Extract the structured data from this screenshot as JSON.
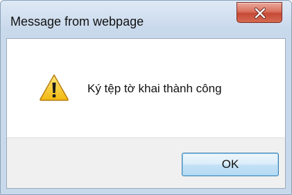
{
  "window": {
    "title": "Message from webpage"
  },
  "dialog": {
    "icon": "warning-icon",
    "message": "Ký tệp tờ khai thành công",
    "ok_label": "OK"
  },
  "titlebar": {
    "close_icon": "close-icon"
  },
  "colors": {
    "close_button": "#c54a36",
    "ok_button_border": "#3c7fb1",
    "warning_fill": "#f5c518",
    "footer_bg": "#f0f0f0"
  }
}
